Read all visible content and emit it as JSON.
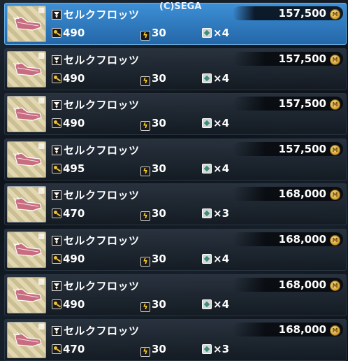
{
  "copyright": "(C)SEGA",
  "items": [
    {
      "name": "セルクフロッツ",
      "price": "157,500",
      "key": "490",
      "bolt": "30",
      "slots": "×4",
      "selected": true
    },
    {
      "name": "セルクフロッツ",
      "price": "157,500",
      "key": "490",
      "bolt": "30",
      "slots": "×4",
      "selected": false
    },
    {
      "name": "セルクフロッツ",
      "price": "157,500",
      "key": "490",
      "bolt": "30",
      "slots": "×4",
      "selected": false
    },
    {
      "name": "セルクフロッツ",
      "price": "157,500",
      "key": "495",
      "bolt": "30",
      "slots": "×4",
      "selected": false
    },
    {
      "name": "セルクフロッツ",
      "price": "168,000",
      "key": "470",
      "bolt": "30",
      "slots": "×3",
      "selected": false
    },
    {
      "name": "セルクフロッツ",
      "price": "168,000",
      "key": "490",
      "bolt": "30",
      "slots": "×4",
      "selected": false
    },
    {
      "name": "セルクフロッツ",
      "price": "168,000",
      "key": "490",
      "bolt": "30",
      "slots": "×4",
      "selected": false
    },
    {
      "name": "セルクフロッツ",
      "price": "168,000",
      "key": "470",
      "bolt": "30",
      "slots": "×3",
      "selected": false
    }
  ],
  "icons": {
    "item_type": "weapon-type-icon",
    "key": "key-icon",
    "bolt": "bolt-icon",
    "slot": "slot-icon",
    "currency": "meseta-icon"
  },
  "colors": {
    "selected_row": "#2e7fc6",
    "row": "#1c2530",
    "meseta": "#d19b2c"
  }
}
